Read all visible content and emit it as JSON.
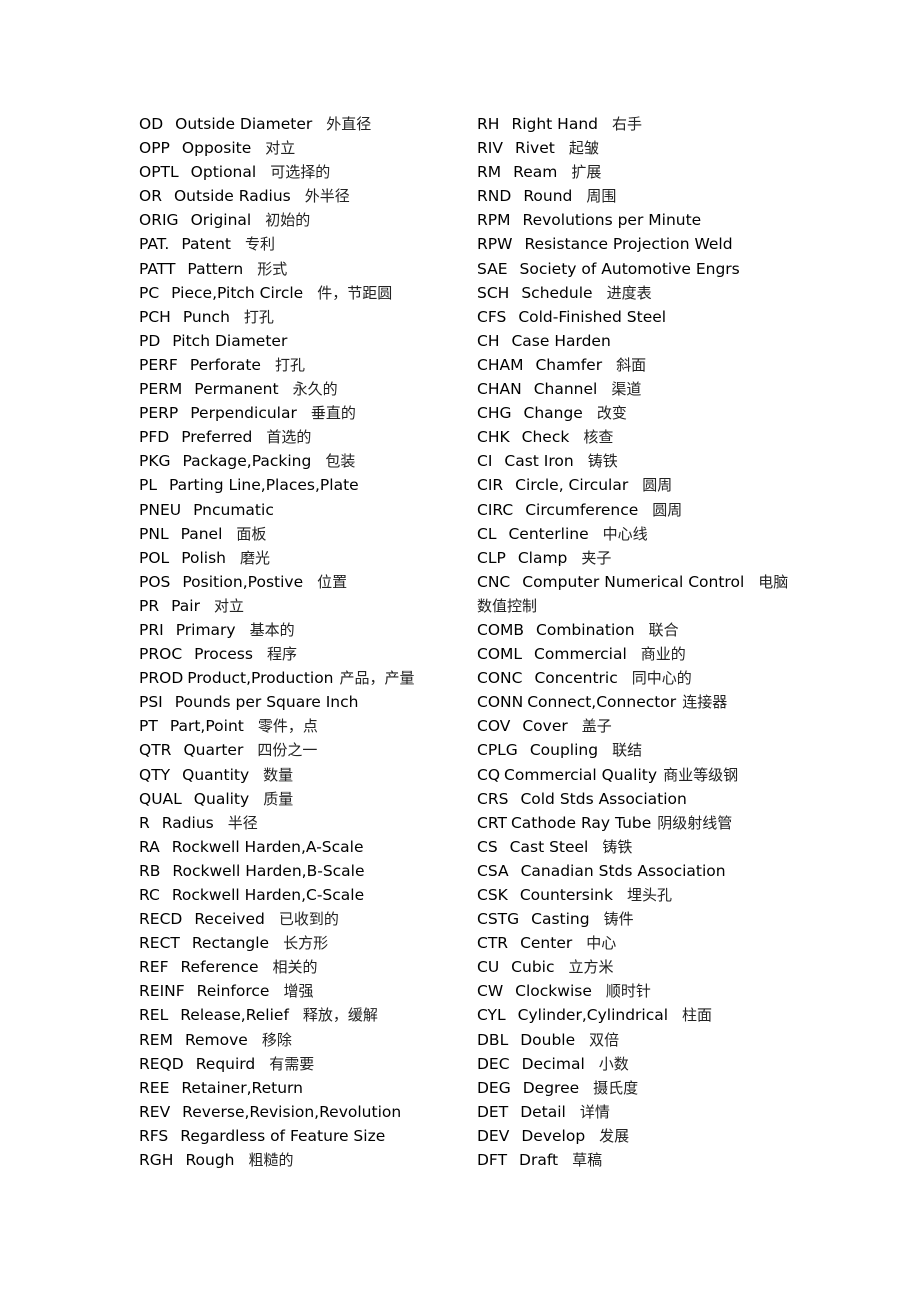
{
  "left_column": [
    {
      "abbr": "OD",
      "term": "Outside Diameter",
      "zh": "外直径"
    },
    {
      "abbr": "OPP",
      "term": "Opposite",
      "zh": "对立"
    },
    {
      "abbr": "OPTL",
      "term": "Optional",
      "zh": "可选择的"
    },
    {
      "abbr": "OR",
      "term": "Outside Radius",
      "zh": "外半径"
    },
    {
      "abbr": "ORIG",
      "term": "Original",
      "zh": "初始的"
    },
    {
      "abbr": "PAT.",
      "term": "Patent",
      "zh": "专利"
    },
    {
      "abbr": "PATT",
      "term": "Pattern",
      "zh": "形式"
    },
    {
      "abbr": "PC",
      "term": "Piece,Pitch Circle",
      "zh": "件，节距圆"
    },
    {
      "abbr": "PCH",
      "term": "Punch",
      "zh": "打孔"
    },
    {
      "abbr": "PD",
      "term": "Pitch Diameter",
      "zh": ""
    },
    {
      "abbr": "PERF",
      "term": "Perforate",
      "zh": "打孔"
    },
    {
      "abbr": "PERM",
      "term": "Permanent",
      "zh": "永久的"
    },
    {
      "abbr": "PERP",
      "term": "Perpendicular",
      "zh": "垂直的"
    },
    {
      "abbr": "PFD",
      "term": "Preferred",
      "zh": "首选的"
    },
    {
      "abbr": "PKG",
      "term": "Package,Packing",
      "zh": "包装"
    },
    {
      "abbr": "PL",
      "term": "Parting Line,Places,Plate",
      "zh": ""
    },
    {
      "abbr": "PNEU",
      "term": "Pncumatic",
      "zh": ""
    },
    {
      "abbr": "PNL",
      "term": "Panel",
      "zh": "面板"
    },
    {
      "abbr": "POL",
      "term": "Polish",
      "zh": "磨光"
    },
    {
      "abbr": "POS",
      "term": "Position,Postive",
      "zh": "位置"
    },
    {
      "abbr": "PR",
      "term": "Pair",
      "zh": "对立"
    },
    {
      "abbr": "PRI",
      "term": "Primary",
      "zh": "基本的"
    },
    {
      "abbr": "PROC",
      "term": "Process",
      "zh": "程序"
    },
    {
      "abbr": "PROD",
      "term": "Product,Production",
      "zh": "产品，产量",
      "tight": true
    },
    {
      "abbr": "PSI",
      "term": "Pounds per Square Inch",
      "zh": ""
    },
    {
      "abbr": "PT",
      "term": "Part,Point",
      "zh": "零件，点"
    },
    {
      "abbr": "QTR",
      "term": "Quarter",
      "zh": "四份之一"
    },
    {
      "abbr": "QTY",
      "term": "Quantity",
      "zh": "数量"
    },
    {
      "abbr": "QUAL",
      "term": "Quality",
      "zh": "质量"
    },
    {
      "abbr": "R",
      "term": "Radius",
      "zh": "半径"
    },
    {
      "abbr": "RA",
      "term": "Rockwell Harden,A-Scale",
      "zh": ""
    },
    {
      "abbr": "RB",
      "term": "Rockwell Harden,B-Scale",
      "zh": ""
    },
    {
      "abbr": "RC",
      "term": "Rockwell Harden,C-Scale",
      "zh": ""
    },
    {
      "abbr": "RECD",
      "term": "Received",
      "zh": "已收到的"
    },
    {
      "abbr": "RECT",
      "term": "Rectangle",
      "zh": "长方形"
    },
    {
      "abbr": "REF",
      "term": "Reference",
      "zh": "相关的"
    },
    {
      "abbr": "REINF",
      "term": "Reinforce",
      "zh": "增强"
    },
    {
      "abbr": "REL",
      "term": "Release,Relief",
      "zh": "释放，缓解"
    },
    {
      "abbr": "REM",
      "term": "Remove",
      "zh": "移除"
    },
    {
      "abbr": "REQD",
      "term": "Requird",
      "zh": "有需要"
    },
    {
      "abbr": "REE",
      "term": "Retainer,Return",
      "zh": ""
    },
    {
      "abbr": "REV",
      "term": "Reverse,Revision,Revolution",
      "zh": ""
    },
    {
      "abbr": "RFS",
      "term": "Regardless of Feature Size",
      "zh": ""
    },
    {
      "abbr": "RGH",
      "term": "Rough",
      "zh": "粗糙的"
    }
  ],
  "right_column": [
    {
      "abbr": "RH",
      "term": "Right Hand",
      "zh": "右手"
    },
    {
      "abbr": "RIV",
      "term": "Rivet",
      "zh": "起皱"
    },
    {
      "abbr": "RM",
      "term": "Ream",
      "zh": "扩展"
    },
    {
      "abbr": "RND",
      "term": "Round",
      "zh": "周围"
    },
    {
      "abbr": "RPM",
      "term": "Revolutions per Minute",
      "zh": ""
    },
    {
      "abbr": "RPW",
      "term": "Resistance Projection Weld",
      "zh": ""
    },
    {
      "abbr": "SAE",
      "term": "Society of Automotive Engrs",
      "zh": ""
    },
    {
      "abbr": "SCH",
      "term": "Schedule",
      "zh": "进度表"
    },
    {
      "abbr": "CFS",
      "term": "Cold-Finished Steel",
      "zh": ""
    },
    {
      "abbr": "CH",
      "term": "Case Harden",
      "zh": ""
    },
    {
      "abbr": "CHAM",
      "term": "Chamfer",
      "zh": "斜面"
    },
    {
      "abbr": "CHAN",
      "term": "Channel",
      "zh": "渠道"
    },
    {
      "abbr": "CHG",
      "term": "Change",
      "zh": "改变"
    },
    {
      "abbr": "CHK",
      "term": "Check",
      "zh": "核查"
    },
    {
      "abbr": "CI",
      "term": "Cast Iron",
      "zh": "铸铁"
    },
    {
      "abbr": "CIR",
      "term": "Circle, Circular",
      "zh": "圆周"
    },
    {
      "abbr": "CIRC",
      "term": "Circumference",
      "zh": "圆周"
    },
    {
      "abbr": "CL",
      "term": "Centerline",
      "zh": "中心线"
    },
    {
      "abbr": "CLP",
      "term": "Clamp",
      "zh": "夹子"
    },
    {
      "abbr": "CNC",
      "term": "Computer Numerical Control",
      "zh": "电脑数值控制",
      "wrap": true
    },
    {
      "abbr": "COMB",
      "term": "Combination",
      "zh": "联合"
    },
    {
      "abbr": "COML",
      "term": "Commercial",
      "zh": "商业的"
    },
    {
      "abbr": "CONC",
      "term": "Concentric",
      "zh": "同中心的"
    },
    {
      "abbr": "CONN",
      "term": "Connect,Connector",
      "zh": "连接器",
      "tight": true
    },
    {
      "abbr": "COV",
      "term": "Cover",
      "zh": "盖子"
    },
    {
      "abbr": "CPLG",
      "term": "Coupling",
      "zh": "联结"
    },
    {
      "abbr": "CQ",
      "term": "Commercial Quality",
      "zh": "商业等级钢",
      "tight": true
    },
    {
      "abbr": "CRS",
      "term": "Cold Stds Association",
      "zh": ""
    },
    {
      "abbr": "CRT",
      "term": "Cathode Ray Tube",
      "zh": "阴级射线管",
      "tight": true
    },
    {
      "abbr": "CS",
      "term": "Cast Steel",
      "zh": "铸铁"
    },
    {
      "abbr": "CSA",
      "term": "Canadian Stds Association",
      "zh": ""
    },
    {
      "abbr": "CSK",
      "term": "Countersink",
      "zh": "埋头孔"
    },
    {
      "abbr": "CSTG",
      "term": "Casting",
      "zh": "铸件"
    },
    {
      "abbr": "CTR",
      "term": "Center",
      "zh": "中心"
    },
    {
      "abbr": "CU",
      "term": "Cubic",
      "zh": "立方米"
    },
    {
      "abbr": "CW",
      "term": "Clockwise",
      "zh": "顺时针"
    },
    {
      "abbr": "CYL",
      "term": "Cylinder,Cylindrical",
      "zh": "柱面"
    },
    {
      "abbr": "DBL",
      "term": "Double",
      "zh": "双倍"
    },
    {
      "abbr": "DEC",
      "term": "Decimal",
      "zh": "小数"
    },
    {
      "abbr": "DEG",
      "term": "Degree",
      "zh": "摄氏度"
    },
    {
      "abbr": "DET",
      "term": "Detail",
      "zh": "详情"
    },
    {
      "abbr": "DEV",
      "term": "Develop",
      "zh": "发展"
    },
    {
      "abbr": "DFT",
      "term": "Draft",
      "zh": "草稿"
    }
  ]
}
